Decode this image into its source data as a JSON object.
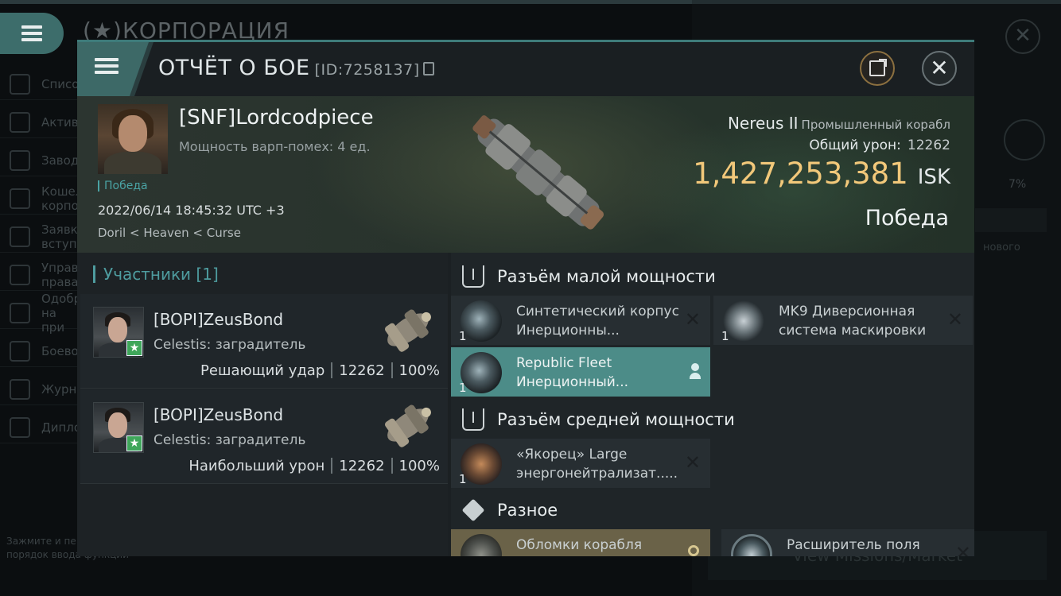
{
  "background": {
    "title": "(★)КОРПОРАЦИЯ",
    "sidebar": [
      "Списо",
      "Актив",
      "Завод",
      "Кошел корпо",
      "Заявк вступ",
      "Управ права",
      "Одобр на при",
      "Боево",
      "Журна",
      "Дипло"
    ],
    "hint": "Зажмите и пе изменить порядок ввода функций",
    "right_pct": "7%",
    "right_text": "нового",
    "bottom_button": "View Missions/Market"
  },
  "header": {
    "title": "ОТЧЁТ О БОЕ",
    "report_id": "[ID:7258137]"
  },
  "victim": {
    "name": "[SNF]Lordcodpiece",
    "warp_strength": "Мощность варп-помех: 4 ед.",
    "tag": "Победа",
    "datetime": "2022/06/14 18:45:32 UTC +3",
    "location": "Doril < Heaven < Curse",
    "ship": "Nereus II",
    "ship_class": "Промышленный корабл",
    "total_damage_label": "Общий урон:",
    "total_damage": "12262",
    "value": "1,427,253,381",
    "value_unit": "ISK",
    "result": "Победа"
  },
  "participants": {
    "title": "Участники [1]",
    "list": [
      {
        "name": "[BOPI]ZeusBond",
        "ship": "Celestis: заградитель",
        "role": "Решающий удар",
        "damage": "12262",
        "percent": "100%"
      },
      {
        "name": "[BOPI]ZeusBond",
        "ship": "Celestis: заградитель",
        "role": "Наибольший урон",
        "damage": "12262",
        "percent": "100%"
      }
    ]
  },
  "fitting": {
    "low": {
      "title": "Разъём малой мощности",
      "items": [
        {
          "qty": "1",
          "name": "Синтетический корпус Инерционны..."
        },
        {
          "qty": "1",
          "name": "MK9 Диверсионная система маскировки"
        },
        {
          "qty": "1",
          "name": "Republic Fleet Инерционный..."
        }
      ]
    },
    "mid": {
      "title": "Разъём средней мощности",
      "items": [
        {
          "qty": "1",
          "name": "«Якорец» Large энергонейтрализат....."
        }
      ]
    },
    "misc": {
      "title": "Разное",
      "items": [
        {
          "name": "Обломки корабля"
        },
        {
          "name": "Расширитель поля"
        }
      ]
    }
  },
  "colors": {
    "accent": "#3e7b7a",
    "isk": "#f2c87a",
    "active_module": "#4c8c88",
    "star_badge": "#3fa65a"
  }
}
